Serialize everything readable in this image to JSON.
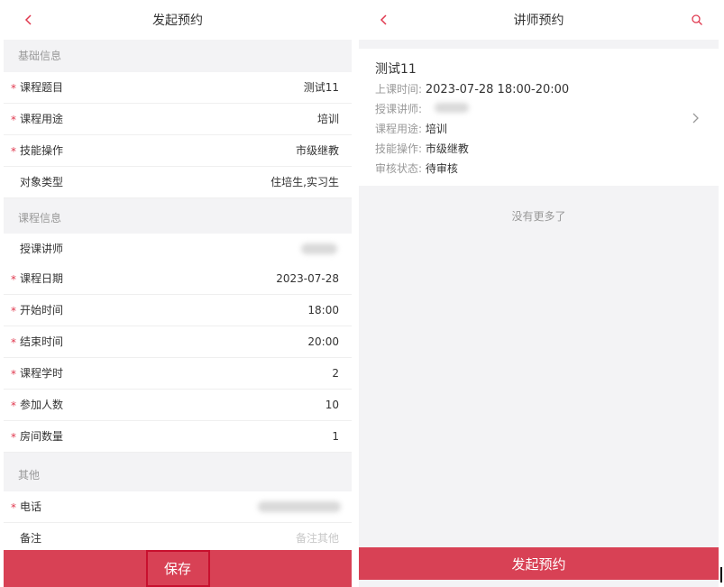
{
  "left": {
    "title": "发起预约",
    "sections": {
      "basic": "基础信息",
      "course": "课程信息",
      "other": "其他"
    },
    "required_mark": "*",
    "rows": {
      "course_topic": {
        "label": "课程题目",
        "value": "测试11"
      },
      "course_purpose": {
        "label": "课程用途",
        "value": "培训"
      },
      "skill_operation": {
        "label": "技能操作",
        "value": "市级继教"
      },
      "target_type": {
        "label": "对象类型",
        "value": "住培生,实习生"
      },
      "lecturer": {
        "label": "授课讲师"
      },
      "course_date": {
        "label": "课程日期",
        "value": "2023-07-28"
      },
      "start_time": {
        "label": "开始时间",
        "value": "18:00"
      },
      "end_time": {
        "label": "结束时间",
        "value": "20:00"
      },
      "course_hours": {
        "label": "课程学时",
        "value": "2"
      },
      "participants": {
        "label": "参加人数",
        "value": "10"
      },
      "room_count": {
        "label": "房间数量",
        "value": "1"
      },
      "phone": {
        "label": "电话"
      },
      "remark": {
        "label": "备注",
        "placeholder": "备注其他"
      }
    },
    "save_label": "保存"
  },
  "right": {
    "title": "讲师预约",
    "card": {
      "title": "测试11",
      "time_label": "上课时间:",
      "time_value": "2023-07-28 18:00-20:00",
      "lecturer_label": "授课讲师:",
      "purpose_label": "课程用途:",
      "purpose_value": "培训",
      "skill_label": "技能操作:",
      "skill_value": "市级继教",
      "status_label": "审核状态:",
      "status_value": "待审核"
    },
    "no_more": "没有更多了",
    "submit_label": "发起预约"
  },
  "colors": {
    "accent": "#d84155",
    "highlight_border": "#c8102e",
    "required": "#e0394f",
    "page_bg": "#f3f3f5"
  },
  "icons": {
    "back": "chevron-left-icon",
    "search": "search-icon",
    "detail": "chevron-right-icon"
  }
}
